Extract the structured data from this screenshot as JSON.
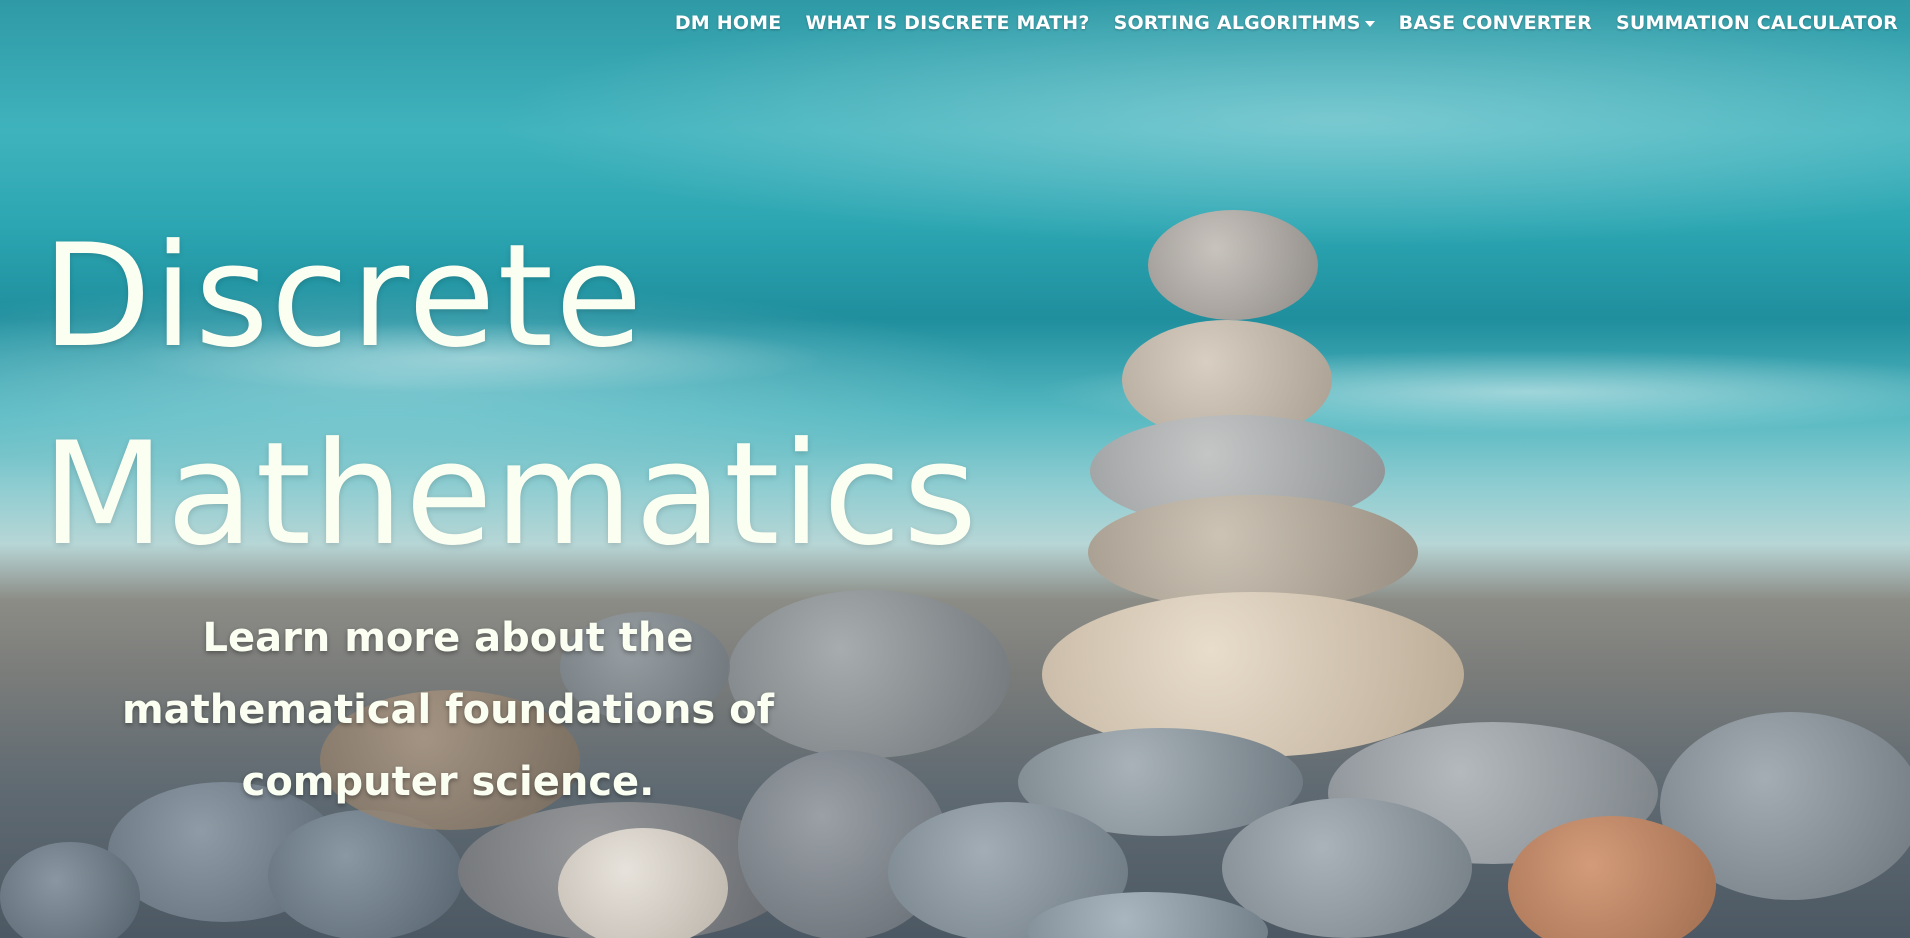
{
  "nav": {
    "items": [
      {
        "label": "DM HOME"
      },
      {
        "label": "WHAT IS DISCRETE MATH?"
      },
      {
        "label": "SORTING ALGORITHMS",
        "icon": "chevron-down-icon"
      },
      {
        "label": "BASE CONVERTER"
      },
      {
        "label": "SUMMATION CALCULATOR"
      }
    ]
  },
  "hero": {
    "title_line1": "Discrete",
    "title_line2": "Mathematics",
    "subtitle": "Learn more about the mathematical foundations of computer science.",
    "image": "beach-stacked-pebbles-background"
  },
  "colors": {
    "text": "#fbfff2",
    "sea": "#2ca6b2",
    "pebble": "#9aa3a9"
  }
}
